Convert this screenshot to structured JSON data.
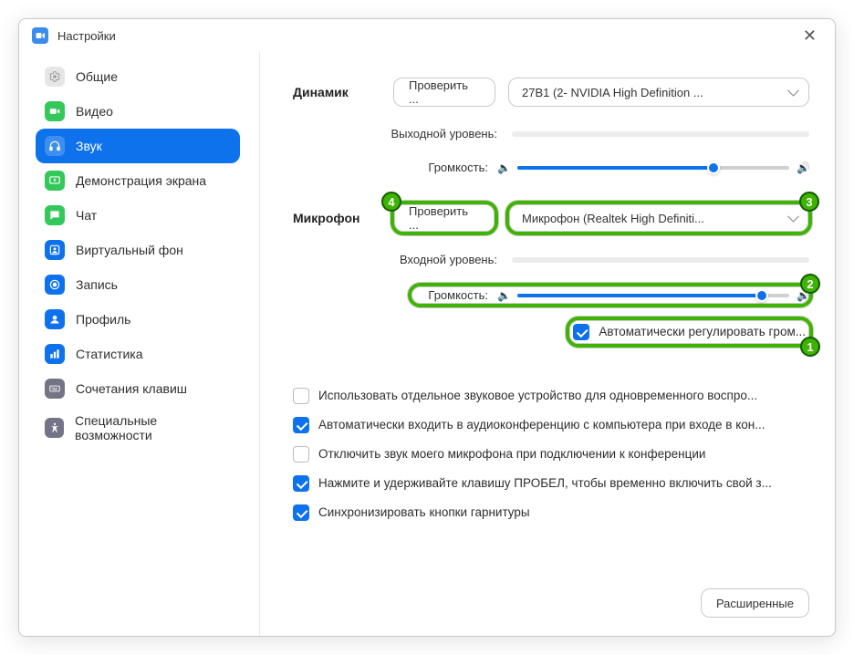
{
  "window": {
    "title": "Настройки"
  },
  "sidebar": {
    "items": [
      {
        "label": "Общие",
        "icon": "gear",
        "color": "#d9d9d9"
      },
      {
        "label": "Видео",
        "icon": "camera",
        "color": "#34c759"
      },
      {
        "label": "Звук",
        "icon": "headphones",
        "color": "#ffffff"
      },
      {
        "label": "Демонстрация экрана",
        "icon": "share",
        "color": "#34c759"
      },
      {
        "label": "Чат",
        "icon": "chat",
        "color": "#34c759"
      },
      {
        "label": "Виртуальный фон",
        "icon": "vbg",
        "color": "#0e72ed"
      },
      {
        "label": "Запись",
        "icon": "record",
        "color": "#0e72ed"
      },
      {
        "label": "Профиль",
        "icon": "profile",
        "color": "#0e72ed"
      },
      {
        "label": "Статистика",
        "icon": "stats",
        "color": "#0e72ed"
      },
      {
        "label": "Сочетания клавиш",
        "icon": "keyboard",
        "color": "#747487"
      },
      {
        "label": "Специальные возможности",
        "icon": "accessibility",
        "color": "#747487"
      }
    ],
    "active_index": 2
  },
  "speaker": {
    "section_label": "Динамик",
    "test_button": "Проверить ...",
    "device": "27B1 (2- NVIDIA High Definition ...",
    "output_level_label": "Выходной уровень:",
    "volume_label": "Громкость:",
    "volume_percent": 72
  },
  "mic": {
    "section_label": "Микрофон",
    "test_button": "Проверить ...",
    "device": "Микрофон (Realtek High Definiti...",
    "input_level_label": "Входной уровень:",
    "volume_label": "Громкость:",
    "volume_percent": 90,
    "auto_adjust": {
      "checked": true,
      "label": "Автоматически регулировать гром..."
    }
  },
  "options": [
    {
      "checked": false,
      "label": "Использовать отдельное звуковое устройство для одновременного воспро..."
    },
    {
      "checked": true,
      "label": "Автоматически входить в аудиоконференцию с компьютера при входе в кон..."
    },
    {
      "checked": false,
      "label": "Отключить звук моего микрофона при подключении к конференции"
    },
    {
      "checked": true,
      "label": "Нажмите и удерживайте клавишу ПРОБЕЛ, чтобы временно включить свой з..."
    },
    {
      "checked": true,
      "label": "Синхронизировать кнопки гарнитуры"
    }
  ],
  "footer": {
    "advanced": "Расширенные"
  },
  "annotations": {
    "1": "auto-volume-checkbox",
    "2": "mic-volume-slider",
    "3": "mic-device-select",
    "4": "mic-test-button"
  }
}
